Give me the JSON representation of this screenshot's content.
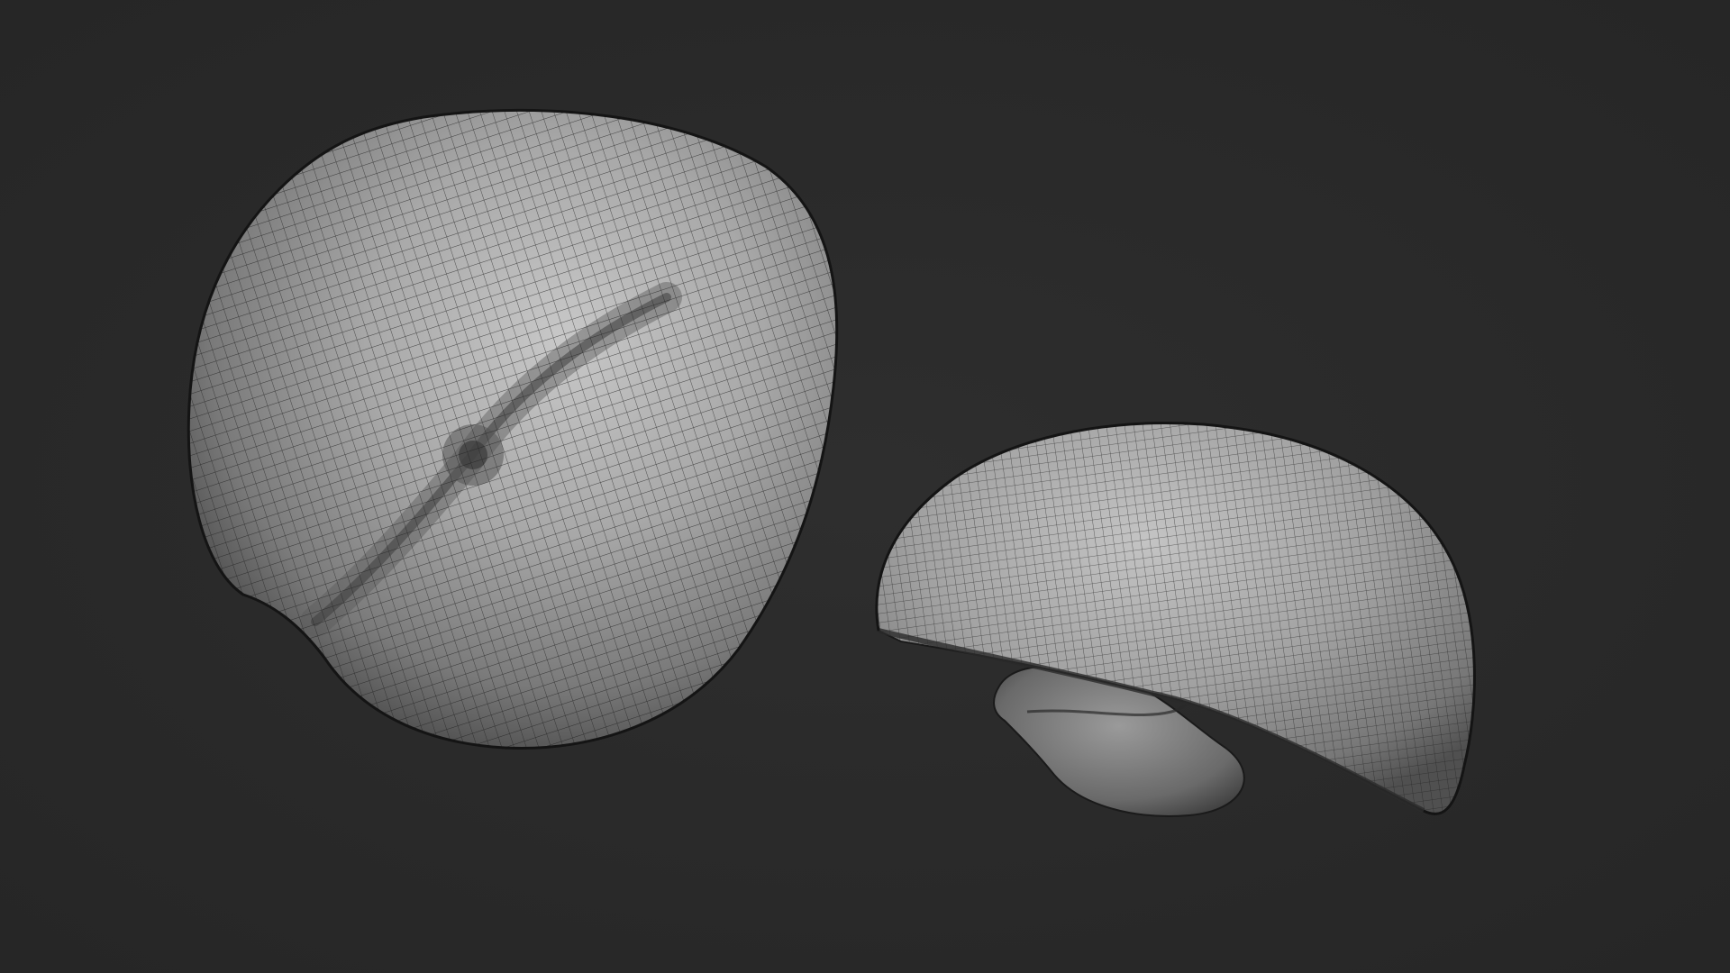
{
  "scene": {
    "background_color": "#2a2a2a",
    "mesh_shade_light": "#b9b9b9",
    "mesh_shade_mid": "#8c8c8c",
    "mesh_shade_dark": "#4a4a4a",
    "wire_color": "#1f1f1f",
    "objects": [
      {
        "name": "whole-peach-mesh",
        "kind": "wireframe-sculpt"
      },
      {
        "name": "half-peach-mesh",
        "kind": "wireframe-sculpt"
      }
    ]
  }
}
